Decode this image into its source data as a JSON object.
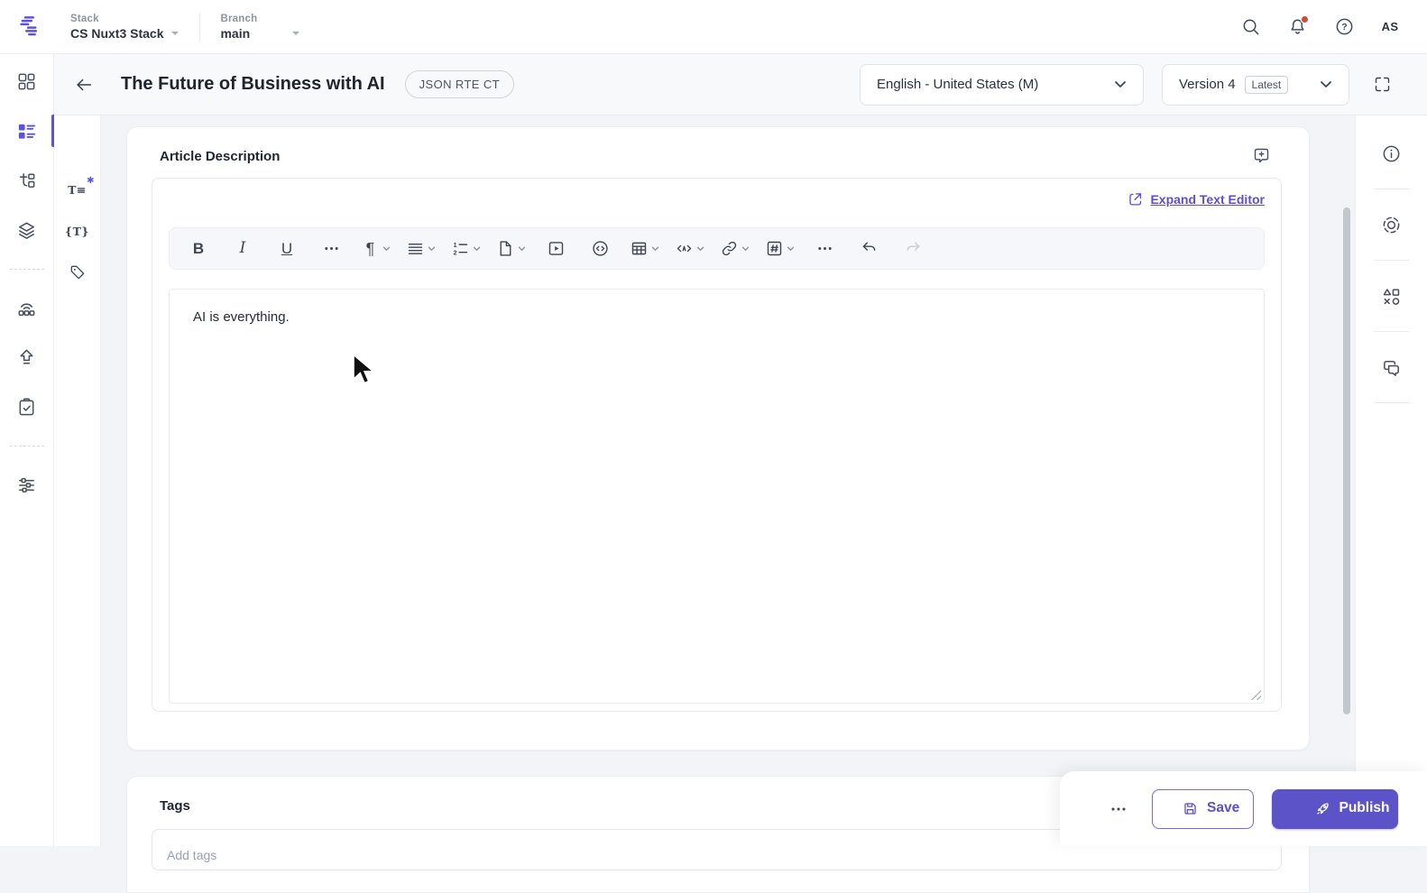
{
  "colors": {
    "accent": "#5D50C6",
    "accent_bright": "#5B53E0",
    "notification_dot": "#CC4B37",
    "main_bg": "#F3F4F7"
  },
  "topbar": {
    "stack": {
      "label": "Stack",
      "value": "CS Nuxt3 Stack"
    },
    "branch": {
      "label": "Branch",
      "value": "main"
    },
    "actions": [
      {
        "icon": "search-icon"
      },
      {
        "icon": "notifications-icon",
        "has_badge": true
      },
      {
        "icon": "help-icon"
      }
    ],
    "avatar_initials": "AS"
  },
  "entry_header": {
    "title": "The Future of Business with AI",
    "content_type_badge": "JSON RTE CT",
    "language_selector": {
      "value": "English - United States (M)"
    },
    "version_selector": {
      "value": "Version 4",
      "badge": "Latest"
    }
  },
  "left_sidebar": {
    "items": [
      {
        "icon": "dashboard-icon"
      },
      {
        "icon": "entries-icon",
        "active": true
      },
      {
        "icon": "content-models-icon"
      },
      {
        "icon": "assets-icon"
      },
      {
        "divider": true
      },
      {
        "icon": "releases-icon"
      },
      {
        "icon": "publish-queue-icon"
      },
      {
        "icon": "tasks-icon"
      },
      {
        "divider": true
      },
      {
        "icon": "settings-icon"
      }
    ]
  },
  "field_navigator": {
    "items": [
      {
        "icon": "text-field-icon",
        "glyph": "T≡",
        "required": true
      },
      {
        "icon": "json-rte-field-icon",
        "glyph": "{T}"
      },
      {
        "icon": "tag-field-icon"
      }
    ]
  },
  "article_panel": {
    "title": "Article Description",
    "expand_link_label": "Expand Text Editor",
    "toolbar": [
      {
        "icon": "bold-icon"
      },
      {
        "icon": "italic-icon"
      },
      {
        "icon": "underline-icon"
      },
      {
        "icon": "more-options-icon"
      },
      {
        "icon": "paragraph-icon",
        "dropdown": true
      },
      {
        "icon": "align-icon",
        "dropdown": true
      },
      {
        "icon": "ordered-list-icon",
        "dropdown": true
      },
      {
        "icon": "document-icon",
        "dropdown": true
      },
      {
        "icon": "video-icon"
      },
      {
        "icon": "embed-icon"
      },
      {
        "icon": "table-icon",
        "dropdown": true
      },
      {
        "icon": "code-tag-icon",
        "dropdown": true
      },
      {
        "icon": "link-icon",
        "dropdown": true
      },
      {
        "icon": "hashtag-icon",
        "dropdown": true
      },
      {
        "icon": "more-options-icon"
      },
      {
        "icon": "undo-icon"
      },
      {
        "icon": "redo-icon",
        "disabled": true
      }
    ],
    "editor_content": "AI is everything."
  },
  "tags_panel": {
    "title": "Tags",
    "input_placeholder": "Add tags"
  },
  "action_bar": {
    "save_label": "Save",
    "publish_label": "Publish"
  },
  "right_sidebar": {
    "items": [
      {
        "icon": "information-icon"
      },
      {
        "icon": "focus-mode-icon"
      },
      {
        "icon": "widgets-icon"
      },
      {
        "icon": "comments-icon"
      }
    ]
  }
}
